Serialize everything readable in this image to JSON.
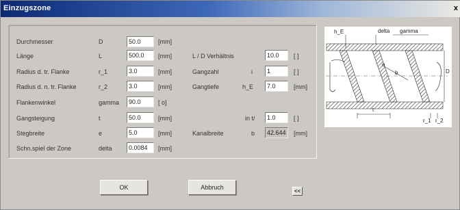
{
  "window": {
    "title": "Einzugszone",
    "close_label": "x"
  },
  "params_left": [
    {
      "label": "Durchmesser",
      "symbol": "D",
      "value": "50.0",
      "unit": "[mm]"
    },
    {
      "label": "Länge",
      "symbol": "L",
      "value": "500.0",
      "unit": "[mm]"
    },
    {
      "label": "Radius d. tr. Flanke",
      "symbol": "r_1",
      "value": "3.0",
      "unit": "[mm]"
    },
    {
      "label": "Radius d. n. tr. Flanke",
      "symbol": "r_2",
      "value": "3.0",
      "unit": "[mm]"
    },
    {
      "label": "Flankenwinkel",
      "symbol": "gamma",
      "value": "90.0",
      "unit": "[ o]"
    },
    {
      "label": "Gangsteigung",
      "symbol": "t",
      "value": "50.0",
      "unit": "[mm]"
    },
    {
      "label": "Stegbreite",
      "symbol": "e",
      "value": "5.0",
      "unit": "[mm]"
    },
    {
      "label": "Schn.spiel der Zone",
      "symbol": "delta",
      "value": "0.0084",
      "unit": "[mm]"
    }
  ],
  "params_right": [
    {
      "label": "L / D  Verhältnis",
      "symbol": "",
      "value": "10.0",
      "unit": "[  ]"
    },
    {
      "label": "Gangzahl",
      "symbol": "i",
      "value": "1",
      "unit": "[  ]"
    },
    {
      "label": "Gangtiefe",
      "symbol": "h_E",
      "value": "7.0",
      "unit": "[mm]"
    },
    {
      "label": "in  t/",
      "symbol": "",
      "value": "1.0",
      "unit": "[  ]"
    },
    {
      "label": "Kanalbreite",
      "symbol": "b",
      "value": "42.644",
      "unit": "[mm]"
    }
  ],
  "buttons": {
    "ok": "OK",
    "cancel": "Abbruch",
    "collapse": "<<"
  },
  "diagram": {
    "labels": {
      "h_E": "h_E",
      "delta": "delta",
      "gamma": "gamma",
      "D": "D",
      "e": "e",
      "b": "b",
      "t": "t",
      "r_1": "r_1",
      "r_2": "r_2"
    }
  }
}
